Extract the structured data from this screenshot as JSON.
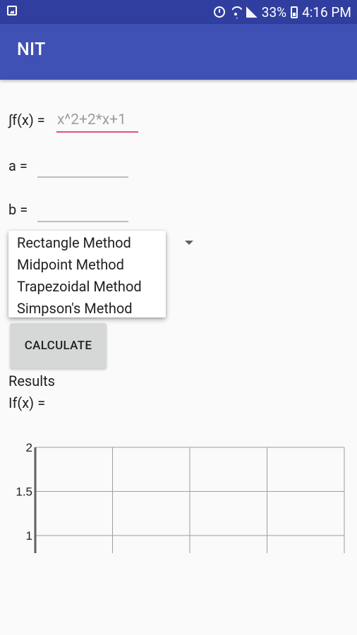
{
  "status_bar": {
    "battery_text": "33%",
    "time": "4:16 PM"
  },
  "app": {
    "title": "NIT"
  },
  "form": {
    "integral_label": "∫f(x) =",
    "integral_placeholder": "x^2+2*x+1",
    "a_label": "a =",
    "a_value": "",
    "b_label": "b =",
    "b_value": ""
  },
  "method_dropdown": {
    "options": [
      "Rectangle Method",
      "Midpoint Method",
      "Trapezoidal Method",
      "Simpson's Method"
    ]
  },
  "buttons": {
    "calculate": "CALCULATE"
  },
  "results": {
    "heading": "Results",
    "integral_label": "If(x) ="
  },
  "chart_data": {
    "type": "line",
    "series": [],
    "y_ticks": [
      "2",
      "1.5",
      "1"
    ],
    "ylim": [
      0.8,
      2
    ],
    "grid": true
  }
}
